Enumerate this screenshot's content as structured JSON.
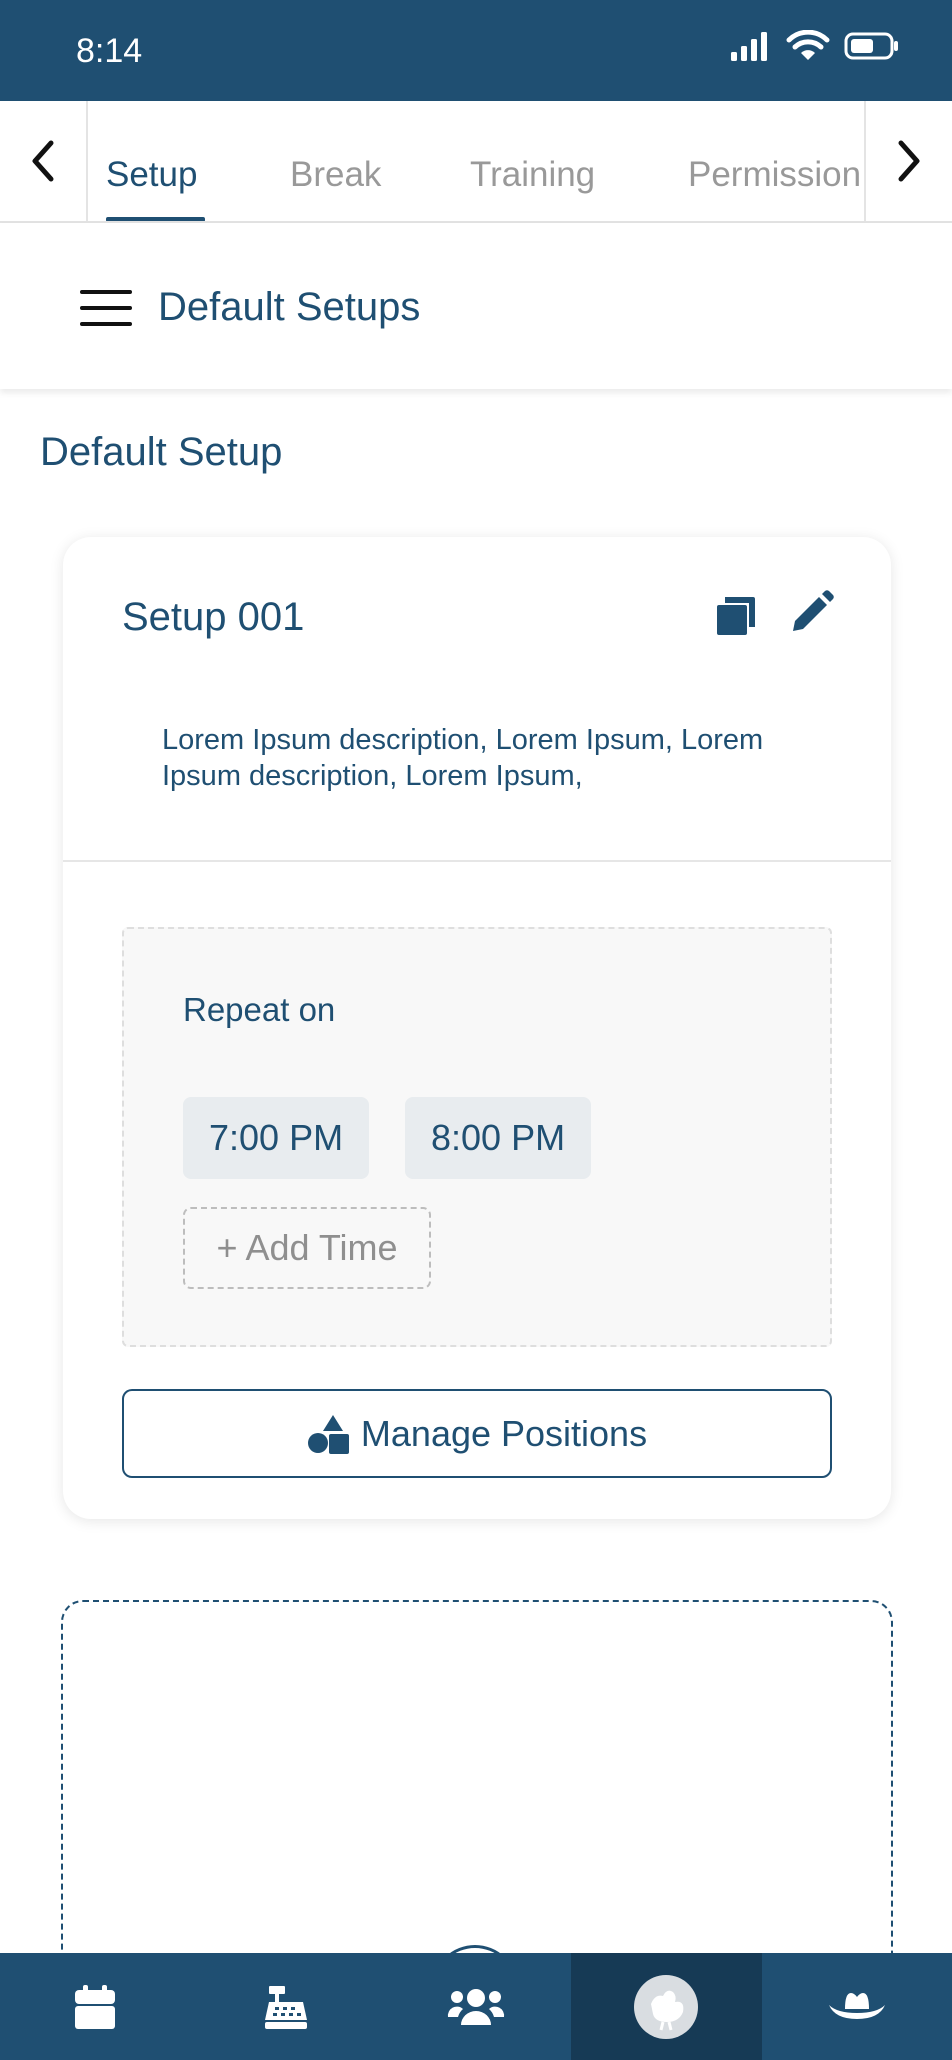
{
  "status_bar": {
    "time": "8:14"
  },
  "tabs": {
    "items": [
      {
        "label": "Setup",
        "active": true
      },
      {
        "label": "Break",
        "active": false
      },
      {
        "label": "Training",
        "active": false
      },
      {
        "label": "Permission",
        "active": false
      }
    ],
    "left_arrow_icon": "chevron-left-icon",
    "right_arrow_icon": "chevron-right-icon"
  },
  "sub_header": {
    "menu_icon": "hamburger-menu-icon",
    "title": "Default Setups"
  },
  "section": {
    "title": "Default Setup"
  },
  "card": {
    "title": "Setup 001",
    "description": "Lorem Ipsum description, Lorem Ipsum, Lorem Ipsum description, Lorem Ipsum,",
    "repeat_label": "Repeat on",
    "times": [
      "7:00 PM",
      "8:00 PM"
    ],
    "add_time_label": "+ Add Time",
    "manage_positions_label": "Manage Positions"
  },
  "bottom_nav": {
    "items": [
      {
        "icon": "calendar-icon",
        "active": false
      },
      {
        "icon": "cash-register-icon",
        "active": false
      },
      {
        "icon": "users-icon",
        "active": false
      },
      {
        "icon": "chicken-icon",
        "active": true
      },
      {
        "icon": "cowboy-hat-icon",
        "active": false
      }
    ]
  },
  "colors": {
    "primary": "#1f4f72",
    "inactive_text": "#999999",
    "chip_bg": "#e8ecef",
    "nav_active": "#163a55"
  }
}
